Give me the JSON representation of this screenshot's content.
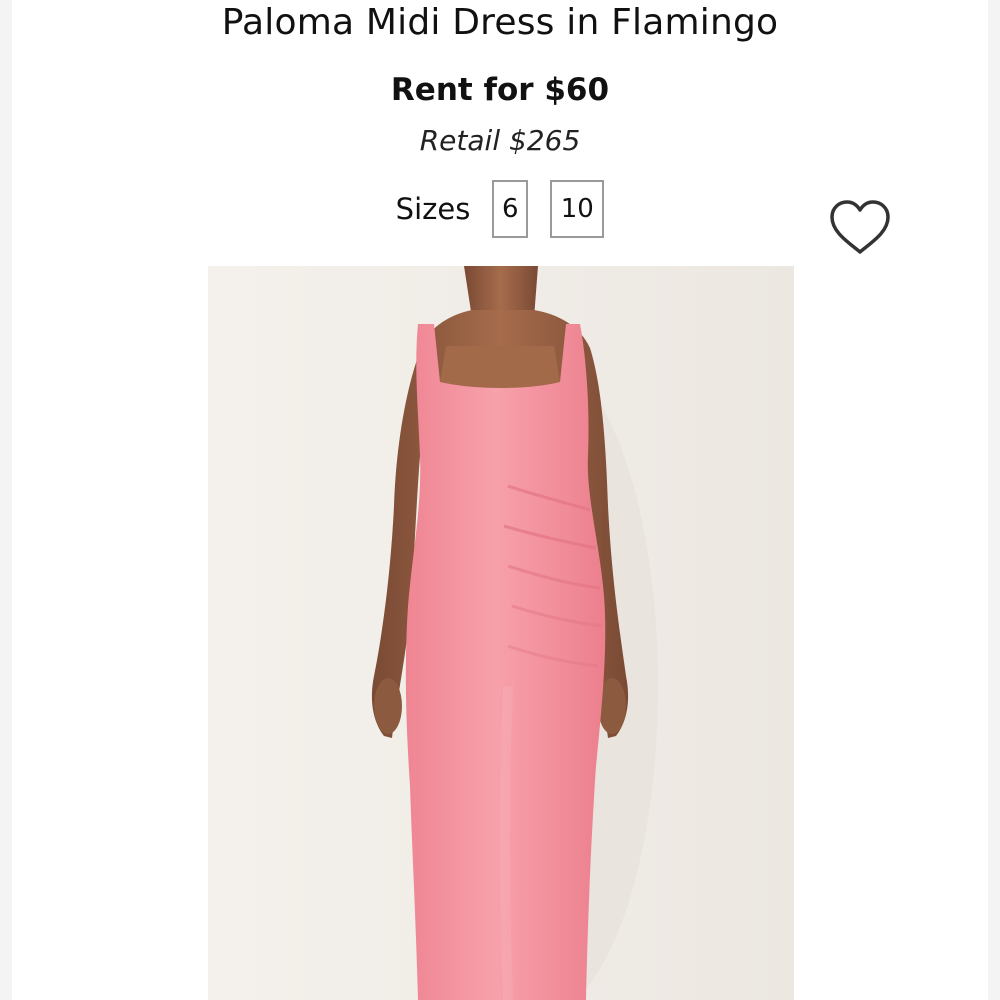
{
  "product": {
    "title": "Paloma Midi Dress in Flamingo",
    "rent_price": "Rent for $60",
    "retail_price": "Retail $265",
    "sizes_label": "Sizes",
    "sizes": [
      "6",
      "10"
    ]
  },
  "icons": {
    "favorite": "heart-outline-icon"
  },
  "image": {
    "subject": "model-wearing-pink-midi-dress",
    "dress_color": "#f4929d",
    "background_color": "#f1ede8"
  }
}
